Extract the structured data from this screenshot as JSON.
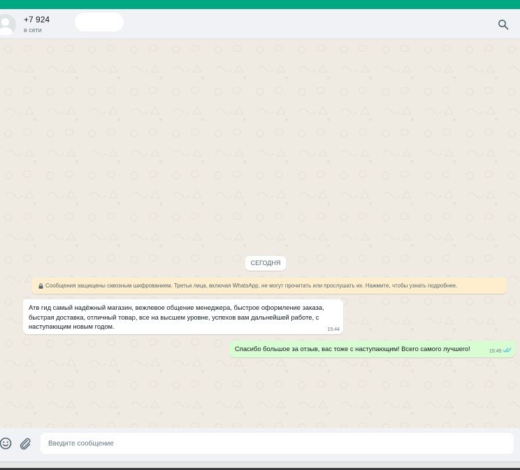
{
  "header": {
    "contact_name": "+7 924 ",
    "status": "в сети",
    "search_icon": "search-icon"
  },
  "chat": {
    "date_chip": "СЕГОДНЯ",
    "encryption_notice": "Сообщения защищены сквозным шифрованием. Третьи лица, включая WhatsApp, не могут прочитать или прослушать их. Нажмите, чтобы узнать подробнее.",
    "messages": [
      {
        "direction": "incoming",
        "text": "Атв гид самый надёжный магазин, вежлевое общение менеджера, быстрое оформление заказа, быстрая доставка, отличный товар,  все на высшем уровне, успехов вам дальнейшей работе, с наступающим новым годом.",
        "time": "15:44"
      },
      {
        "direction": "outgoing",
        "text": "Спасибо большое за отзыв, вас тоже с наступающим! Всего самого лучшего!",
        "time": "15:45",
        "status_icon": "double-check-read-icon"
      }
    ]
  },
  "composer": {
    "placeholder": "Введите сообщение",
    "emoji_icon": "emoji-icon",
    "attach_icon": "paperclip-icon"
  },
  "colors": {
    "accent": "#00a884",
    "header_bg": "#f0f2f5",
    "chat_bg": "#efeae2",
    "outgoing_bubble": "#d9fdd3",
    "notice_bg": "#ffeecd",
    "read_ticks": "#53bdeb"
  }
}
